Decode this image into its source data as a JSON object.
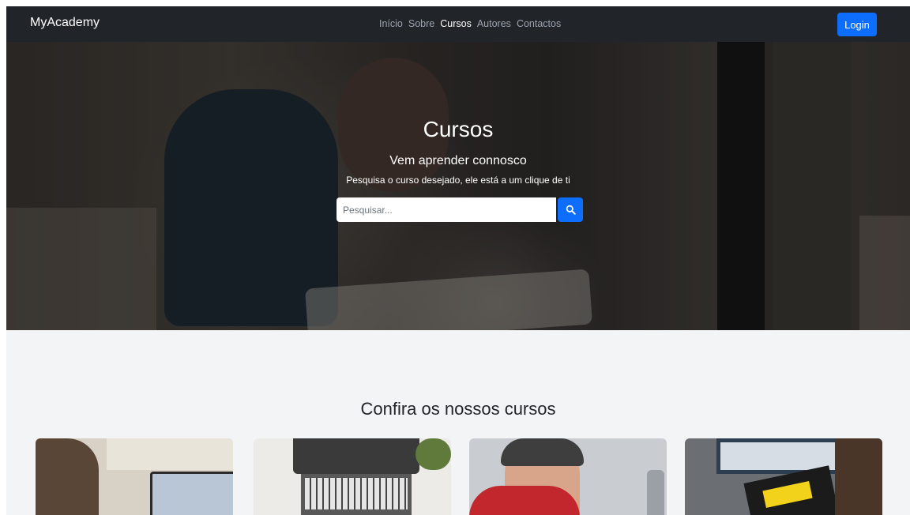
{
  "navbar": {
    "brand": "MyAcademy",
    "links": [
      {
        "label": "Início",
        "active": false
      },
      {
        "label": "Sobre",
        "active": false
      },
      {
        "label": "Cursos",
        "active": true
      },
      {
        "label": "Autores",
        "active": false
      },
      {
        "label": "Contactos",
        "active": false
      }
    ],
    "login_label": "Login"
  },
  "hero": {
    "title": "Cursos",
    "subtitle": "Vem aprender connosco",
    "description": "Pesquisa o curso desejado, ele está a um clique de ti",
    "search_placeholder": "Pesquisar...",
    "search_icon": "search-icon"
  },
  "courses": {
    "title": "Confira os nossos cursos"
  },
  "colors": {
    "navbar_bg": "#212529",
    "primary": "#0d6efd",
    "page_bg": "#f3f4f6"
  }
}
